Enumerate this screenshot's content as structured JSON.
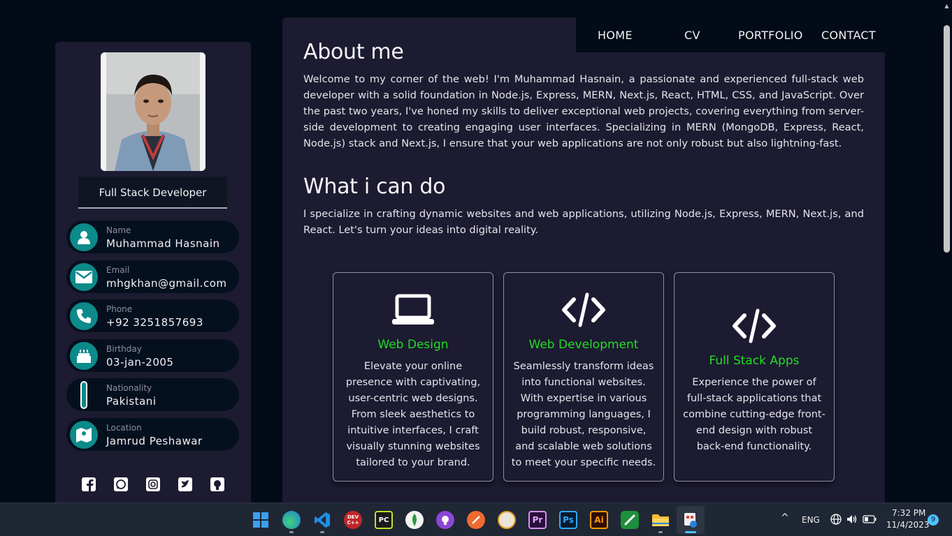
{
  "nav": {
    "items": [
      "HOME",
      "CV",
      "PORTFOLIO",
      "CONTACT"
    ]
  },
  "profile": {
    "role": "Full Stack Developer",
    "info": [
      {
        "label": "Name",
        "value": "Muhammad Hasnain",
        "icon": "user-icon"
      },
      {
        "label": "Email",
        "value": "mhgkhan@gmail.com",
        "icon": "envelope-icon"
      },
      {
        "label": "Phone",
        "value": "+92 3251857693",
        "icon": "phone-icon"
      },
      {
        "label": "Birthday",
        "value": "03-jan-2005",
        "icon": "cake-icon"
      },
      {
        "label": "Nationality",
        "value": "Pakistani",
        "icon": "flag-icon"
      },
      {
        "label": "Location",
        "value": "Jamrud Peshawar",
        "icon": "map-icon"
      }
    ],
    "socials": [
      "facebook-icon",
      "whatsapp-icon",
      "instagram-icon",
      "twitter-icon",
      "github-icon"
    ]
  },
  "about": {
    "title": "About me",
    "text": "Welcome to my corner of the web! I'm Muhammad Hasnain, a passionate and experienced full-stack web developer with a solid foundation in Node.js, Express, MERN, Next.js, React, HTML, CSS, and JavaScript. Over the past two years, I've honed my skills to deliver exceptional web projects, covering everything from server-side development to creating engaging user interfaces. Specializing in MERN (MongoDB, Express, React, Node.js) stack and Next.js, I ensure that your web applications are not only robust but also lightning-fast."
  },
  "skills": {
    "title": "What i can do",
    "text": "I specialize in crafting dynamic websites and web applications, utilizing Node.js, Express, MERN, Next.js, and React. Let's turn your ideas into digital reality.",
    "cards": [
      {
        "title": "Web Design",
        "icon": "laptop-icon",
        "text": "Elevate your online presence with captivating, user-centric web designs. From sleek aesthetics to intuitive interfaces, I craft visually stunning websites tailored to your brand."
      },
      {
        "title": "Web Development",
        "icon": "code-icon",
        "text": "Seamlessly transform ideas into functional websites. With expertise in various programming languages, I build robust, responsive, and scalable web solutions to meet your specific needs."
      },
      {
        "title": "Full Stack Apps",
        "icon": "code-icon",
        "text": "Experience the power of full-stack applications that combine cutting-edge front-end design with robust back-end functionality."
      }
    ]
  },
  "taskbar": {
    "apps": [
      {
        "name": "start-icon",
        "label": ""
      },
      {
        "name": "edge-icon",
        "label": ""
      },
      {
        "name": "vscode-icon",
        "label": ""
      },
      {
        "name": "devcpp-icon",
        "label": "DEV C++"
      },
      {
        "name": "pycharm-icon",
        "label": "PC"
      },
      {
        "name": "mongodb-icon",
        "label": ""
      },
      {
        "name": "github-desktop-icon",
        "label": ""
      },
      {
        "name": "postman-icon",
        "label": ""
      },
      {
        "name": "wamp-icon",
        "label": ""
      },
      {
        "name": "premiere-icon",
        "label": "Pr"
      },
      {
        "name": "photoshop-icon",
        "label": "Ps"
      },
      {
        "name": "illustrator-icon",
        "label": "Ai"
      },
      {
        "name": "pen-app-icon",
        "label": ""
      },
      {
        "name": "file-explorer-icon",
        "label": ""
      },
      {
        "name": "snipping-tool-icon",
        "label": ""
      }
    ],
    "language": "ENG",
    "time": "7:32 PM",
    "date": "11/4/2023",
    "notifications": "9"
  }
}
